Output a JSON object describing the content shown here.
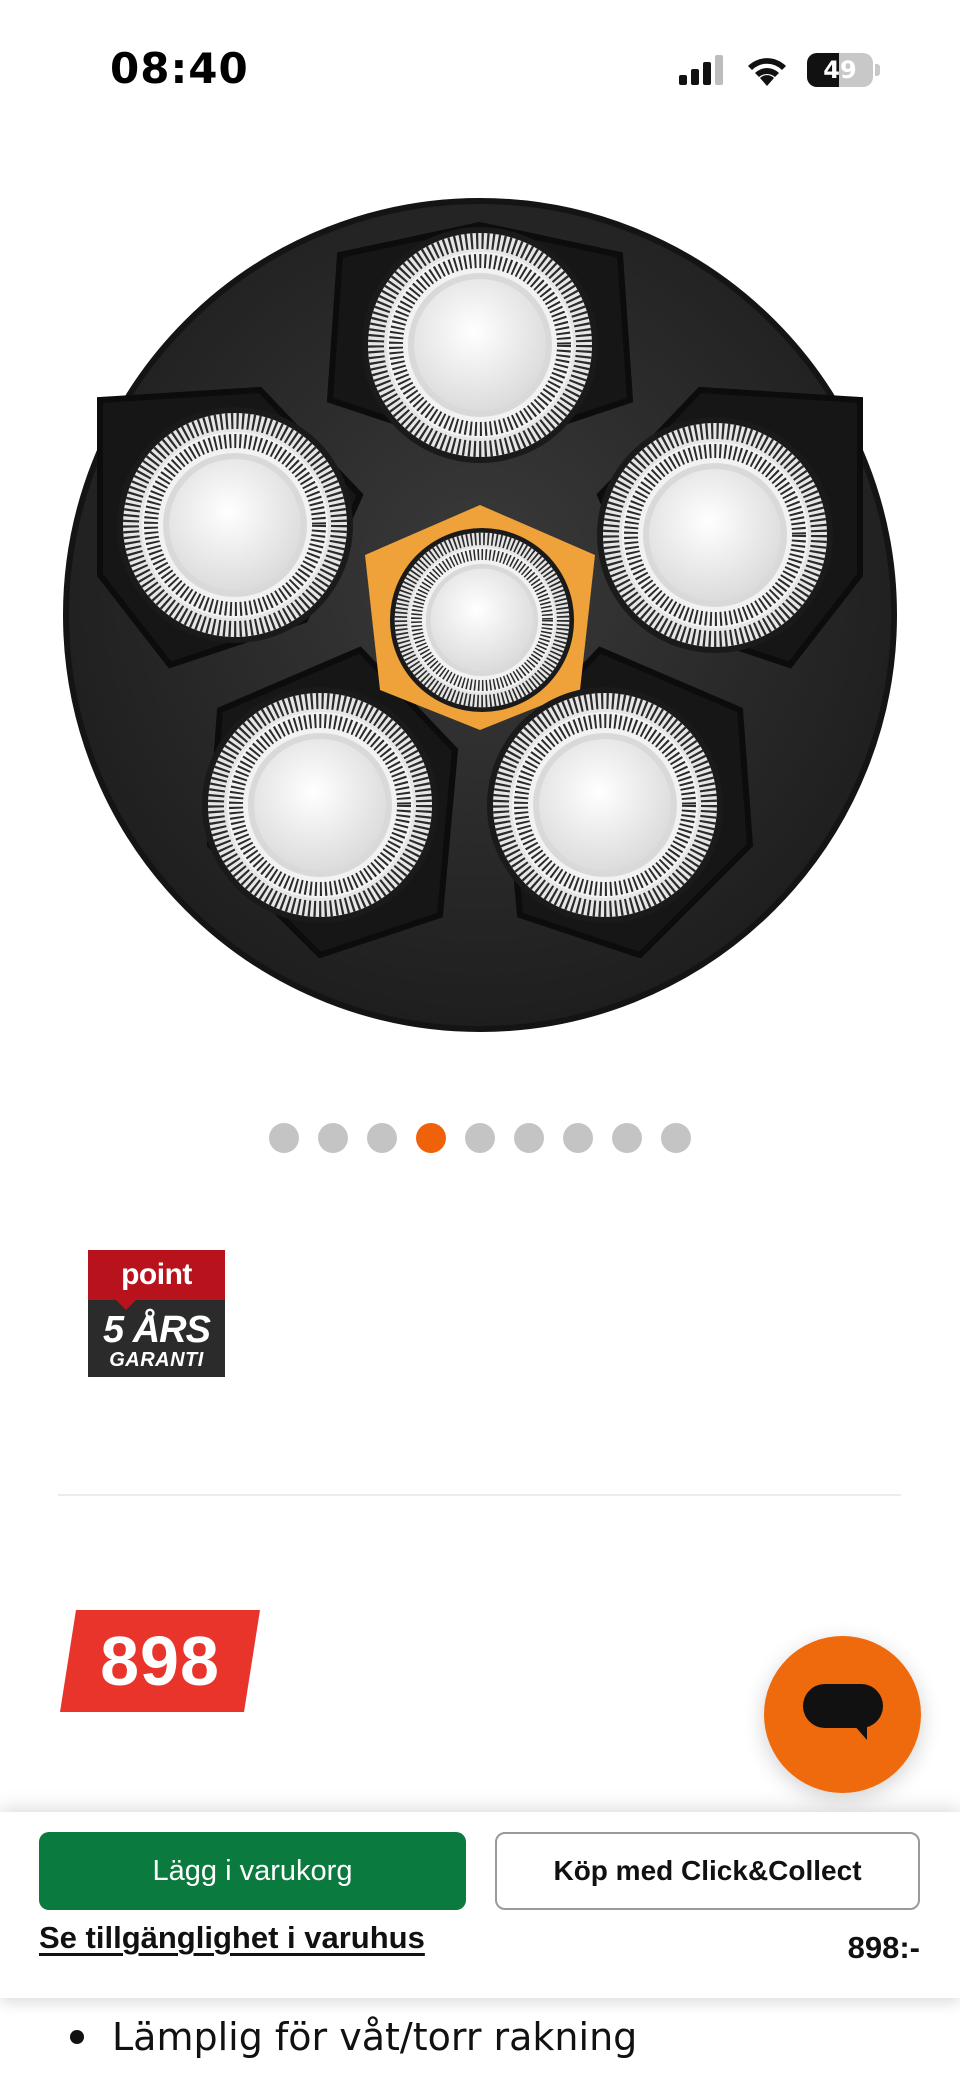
{
  "status_bar": {
    "time": "08:40",
    "battery": "49",
    "icons": [
      "signal-icon",
      "wifi-icon",
      "battery-icon"
    ]
  },
  "product_gallery": {
    "image": "shaver-head-icon",
    "dots_total": 9,
    "active_dot_index": 3
  },
  "warranty_badge": {
    "brand": "point",
    "years": "5 ÅRS",
    "label": "GARANTI"
  },
  "price": {
    "value": "898"
  },
  "bottom_bar": {
    "add_to_cart_label": "Lägg i varukorg",
    "click_collect_label": "Köp med Click&Collect",
    "availability_link": "Se tillgänglighet i varuhus",
    "price": "898:-"
  },
  "features": [
    "Lämplig för våt/torr rakning"
  ],
  "colors": {
    "accent_orange": "#f0620a",
    "cart_green": "#0a7a3e",
    "price_red": "#e8342a",
    "inactive_dot": "#c4c4c4"
  }
}
